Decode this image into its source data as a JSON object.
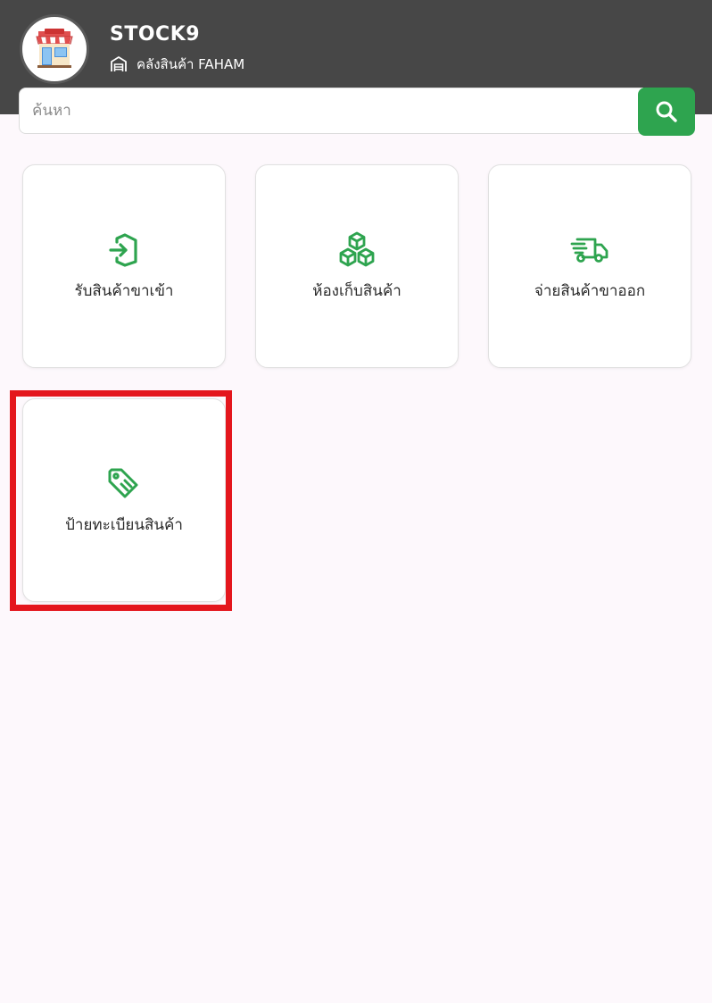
{
  "header": {
    "app_title": "STOCK9",
    "warehouse_label": "คลังสินค้า FAHAM",
    "background_color": "#474747",
    "avatar_icon": "storefront-icon",
    "warehouse_icon": "warehouse-icon"
  },
  "search": {
    "placeholder": "ค้นหา",
    "value": "",
    "button_icon": "search-icon",
    "button_color": "#2ea44f"
  },
  "menu": {
    "items": [
      {
        "label": "รับสินค้าขาเข้า",
        "icon": "import-icon"
      },
      {
        "label": "ห้องเก็บสินค้า",
        "icon": "boxes-icon"
      },
      {
        "label": "จ่ายสินค้าขาออก",
        "icon": "delivery-truck-icon"
      },
      {
        "label": "ป้ายทะเบียนสินค้า",
        "icon": "tag-icon",
        "highlighted": true
      }
    ],
    "accent_color": "#2ea44f",
    "highlight_color": "#e4161d"
  }
}
